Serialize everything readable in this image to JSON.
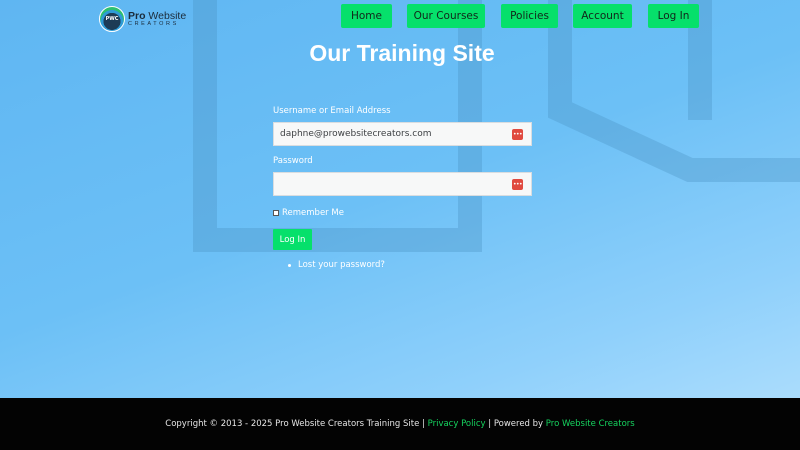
{
  "brand": {
    "logo_mark_text": "PWC",
    "name_bold": "Pro",
    "name_rest": " Website",
    "subtitle": "CREATORS"
  },
  "nav": {
    "items": [
      {
        "label": "Home"
      },
      {
        "label": "Our Courses"
      },
      {
        "label": "Policies"
      },
      {
        "label": "Account"
      },
      {
        "label": "Log In"
      }
    ]
  },
  "page": {
    "title": "Our Training Site"
  },
  "login_form": {
    "username_label": "Username or Email Address",
    "username_value": "daphne@prowebsitecreators.com",
    "password_label": "Password",
    "password_value": "",
    "field_icon_glyph": "•••",
    "remember_label": "Remember Me",
    "remember_checked": false,
    "submit_label": "Log In",
    "lost_password_label": "Lost your password?"
  },
  "footer": {
    "copyright": "Copyright © 2013 - 2025 Pro Website Creators Training Site | ",
    "privacy_label": "Privacy Policy",
    "separator": " | Powered by ",
    "powered_by_label": "Pro Website Creators"
  },
  "colors": {
    "accent_green": "#06e06b",
    "footer_bg": "#030303",
    "footer_link": "#16d35f",
    "background_blue": "#6cc0f6"
  },
  "icons": [
    "password-manager-icon",
    "bullet-icon"
  ]
}
